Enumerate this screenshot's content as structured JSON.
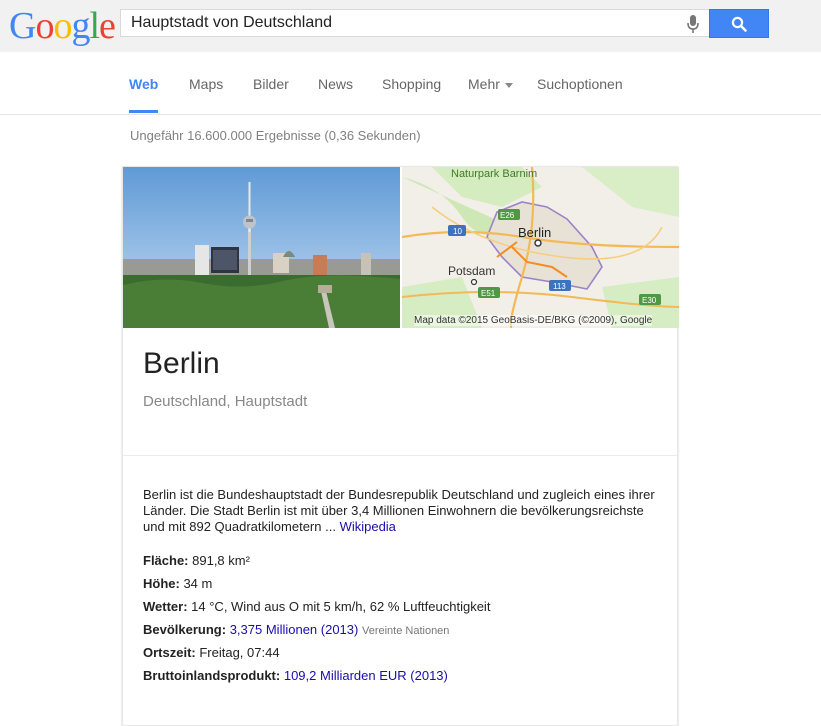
{
  "header": {
    "logo": {
      "letters": [
        "G",
        "o",
        "o",
        "g",
        "l",
        "e"
      ],
      "colors": [
        "#4285f4",
        "#ea4335",
        "#fbbc05",
        "#4285f4",
        "#34a853",
        "#ea4335"
      ]
    },
    "search": {
      "value": "Hauptstadt von Deutschland",
      "placeholder": ""
    },
    "icons": {
      "mic": "microphone-icon",
      "search": "search-icon"
    },
    "colors": {
      "search_button": "#4285f4"
    }
  },
  "tabs": [
    {
      "label": "Web",
      "active": true
    },
    {
      "label": "Maps"
    },
    {
      "label": "Bilder"
    },
    {
      "label": "News"
    },
    {
      "label": "Shopping"
    },
    {
      "label": "Mehr"
    },
    {
      "label": "Suchoptionen"
    }
  ],
  "results": {
    "stats": "Ungefähr 16.600.000 Ergebnisse (0,36 Sekunden)"
  },
  "knowledge_panel": {
    "map": {
      "labels": {
        "park": "Naturpark Barnim",
        "city": "Berlin",
        "potsdam": "Potsdam",
        "e26": "E26",
        "r10": "10",
        "r113": "113",
        "e51": "E51",
        "e30": "E30"
      },
      "credit": "Map data ©2015 GeoBasis-DE/BKG (©2009), Google"
    },
    "title": "Berlin",
    "subtitle": "Deutschland, Hauptstadt",
    "description": "Berlin ist die Bundeshauptstadt der Bundesrepublik Deutschland und zugleich eines ihrer Länder. Die Stadt Berlin ist mit über 3,4 Millionen Einwohnern die bevölkerungsreichste und mit 892 Quadratkilometern ...",
    "description_link": "Wikipedia",
    "facts": [
      {
        "label": "Fläche:",
        "value": " 891,8 km²"
      },
      {
        "label": "Höhe:",
        "value": " 34 m"
      },
      {
        "label": "Wetter:",
        "value": " 14 °C, Wind aus O mit 5 km/h, 62 % Luftfeuchtigkeit"
      },
      {
        "label": "Bevölkerung:",
        "link": "3,375 Millionen (2013)",
        "source": "Vereinte Nationen"
      },
      {
        "label": "Ortszeit:",
        "value": " Freitag, 07:44"
      },
      {
        "label": "Bruttoinlandsprodukt:",
        "link": "109,2 Milliarden EUR (2013)"
      }
    ]
  }
}
